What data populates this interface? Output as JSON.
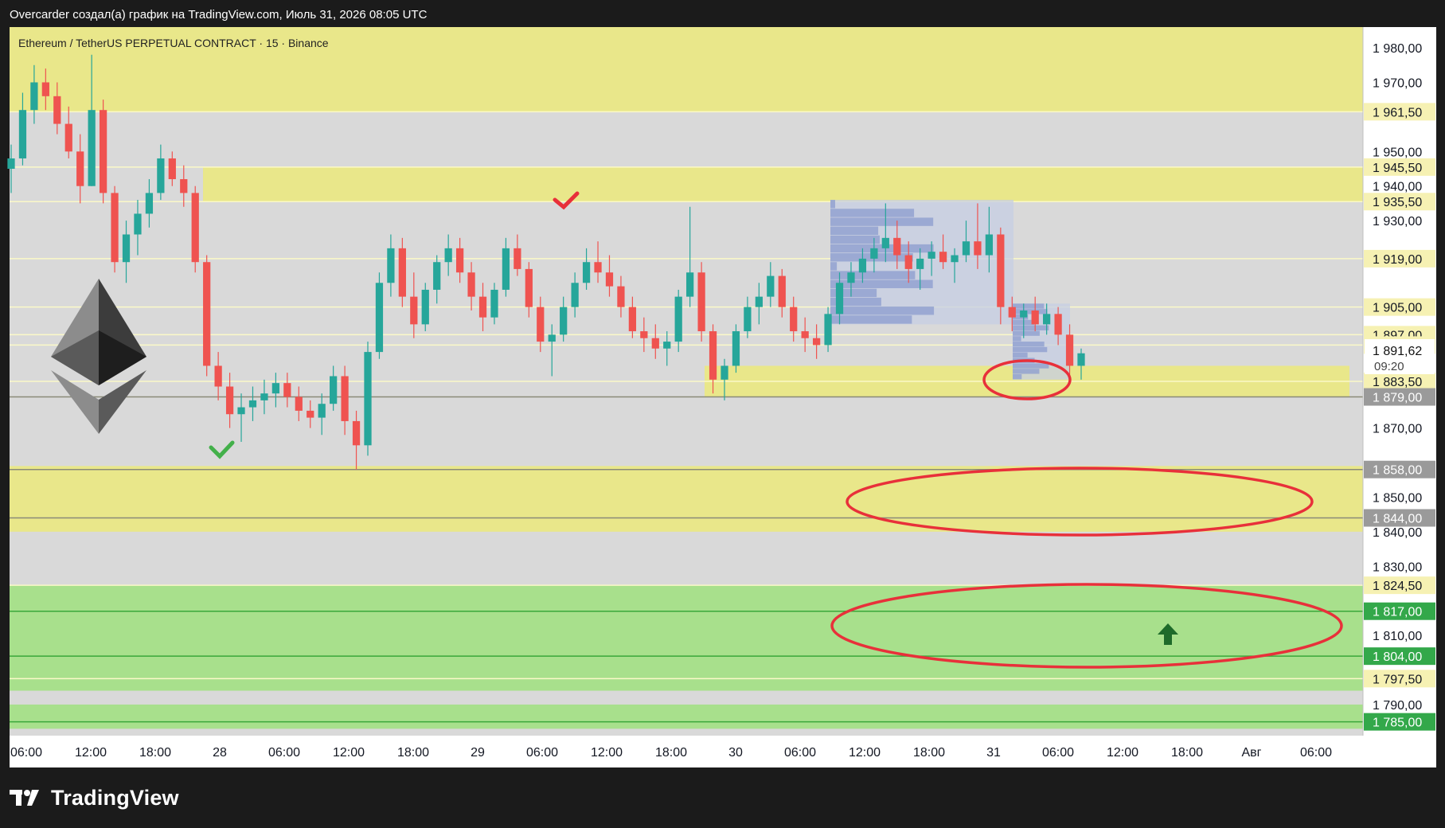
{
  "header": {
    "caption": "Overcarder создал(а) график на TradingView.com, Июль 31, 2026 08:05 UTC"
  },
  "footer": {
    "brand": "TradingView"
  },
  "chart_data": {
    "type": "candlestick",
    "title": "Ethereum / TetherUS PERPETUAL CONTRACT · 15 · Binance",
    "logo": "ethereum-logo",
    "colors": {
      "up": "#26a69a",
      "down": "#ef5350",
      "chart_bg": "#d9d9d9",
      "supply_zone": "#e9e78a",
      "demand_zone": "#a8e08c",
      "annotation": "#e8303a"
    },
    "y_axis": {
      "range": [
        1781,
        1986
      ],
      "ticks": [
        "1 980,00",
        "1 970,00",
        "1 950,00",
        "1 940,00",
        "1 930,00",
        "1 870,00",
        "1 850,00",
        "1 840,00",
        "1 830,00",
        "1 810,00",
        "1 790,00"
      ]
    },
    "x_axis": {
      "labels": [
        "06:00",
        "12:00",
        "18:00",
        "28",
        "06:00",
        "12:00",
        "18:00",
        "29",
        "06:00",
        "12:00",
        "18:00",
        "30",
        "06:00",
        "12:00",
        "18:00",
        "31",
        "06:00",
        "12:00",
        "18:00",
        "Авг",
        "06:00"
      ]
    },
    "current_price": {
      "value": 1891.62,
      "label": "1 891,62",
      "countdown": "09:20"
    },
    "price_levels": [
      {
        "label": "1 961,50",
        "value": 1961.5,
        "style": "yellow"
      },
      {
        "label": "1 945,50",
        "value": 1945.5,
        "style": "yellow"
      },
      {
        "label": "1 935,50",
        "value": 1935.5,
        "style": "yellow"
      },
      {
        "label": "1 919,00",
        "value": 1919.0,
        "style": "yellow"
      },
      {
        "label": "1 905,00",
        "value": 1905.0,
        "style": "yellow"
      },
      {
        "label": "1 897,00",
        "value": 1897.0,
        "style": "yellow"
      },
      {
        "label": "1 894,00",
        "value": 1894.0,
        "style": "yellow"
      },
      {
        "label": "1 883,50",
        "value": 1883.5,
        "style": "yellow"
      },
      {
        "label": "1 879,00",
        "value": 1879.0,
        "style": "gray"
      },
      {
        "label": "1 858,00",
        "value": 1858.0,
        "style": "gray"
      },
      {
        "label": "1 844,00",
        "value": 1844.0,
        "style": "gray"
      },
      {
        "label": "1 824,50",
        "value": 1824.5,
        "style": "yellow"
      },
      {
        "label": "1 817,00",
        "value": 1817.0,
        "style": "green"
      },
      {
        "label": "1 804,00",
        "value": 1804.0,
        "style": "green"
      },
      {
        "label": "1 797,50",
        "value": 1797.5,
        "style": "yellow"
      },
      {
        "label": "1 785,00",
        "value": 1785.0,
        "style": "green"
      }
    ],
    "zones": [
      {
        "type": "supply",
        "from": 1961.5,
        "to": 1986
      },
      {
        "type": "supply",
        "from": 1935.5,
        "to": 1945.5
      },
      {
        "type": "supply",
        "from": 1879,
        "to": 1888
      },
      {
        "type": "supply",
        "from": 1840,
        "to": 1859
      },
      {
        "type": "demand",
        "from": 1794,
        "to": 1824.5
      },
      {
        "type": "demand",
        "from": 1783,
        "to": 1790
      }
    ],
    "candles_ohlc": [
      [
        1945,
        1952,
        1938,
        1948
      ],
      [
        1948,
        1967,
        1946,
        1962
      ],
      [
        1962,
        1975,
        1958,
        1970
      ],
      [
        1970,
        1974,
        1962,
        1966
      ],
      [
        1966,
        1970,
        1955,
        1958
      ],
      [
        1958,
        1963,
        1948,
        1950
      ],
      [
        1950,
        1955,
        1935,
        1940
      ],
      [
        1940,
        1978,
        1940,
        1962
      ],
      [
        1962,
        1965,
        1935,
        1938
      ],
      [
        1938,
        1940,
        1915,
        1918
      ],
      [
        1918,
        1930,
        1912,
        1926
      ],
      [
        1926,
        1936,
        1920,
        1932
      ],
      [
        1932,
        1942,
        1928,
        1938
      ],
      [
        1938,
        1952,
        1936,
        1948
      ],
      [
        1948,
        1950,
        1940,
        1942
      ],
      [
        1942,
        1946,
        1934,
        1938
      ],
      [
        1938,
        1940,
        1915,
        1918
      ],
      [
        1918,
        1920,
        1885,
        1888
      ],
      [
        1888,
        1892,
        1878,
        1882
      ],
      [
        1882,
        1886,
        1870,
        1874
      ],
      [
        1874,
        1880,
        1866,
        1876
      ],
      [
        1876,
        1882,
        1872,
        1878
      ],
      [
        1878,
        1884,
        1874,
        1880
      ],
      [
        1880,
        1886,
        1876,
        1883
      ],
      [
        1883,
        1886,
        1876,
        1879
      ],
      [
        1879,
        1882,
        1872,
        1875
      ],
      [
        1875,
        1878,
        1870,
        1873
      ],
      [
        1873,
        1880,
        1868,
        1877
      ],
      [
        1877,
        1888,
        1875,
        1885
      ],
      [
        1885,
        1888,
        1868,
        1872
      ],
      [
        1872,
        1875,
        1858,
        1865
      ],
      [
        1865,
        1895,
        1862,
        1892
      ],
      [
        1892,
        1915,
        1890,
        1912
      ],
      [
        1912,
        1926,
        1908,
        1922
      ],
      [
        1922,
        1925,
        1905,
        1908
      ],
      [
        1908,
        1915,
        1896,
        1900
      ],
      [
        1900,
        1912,
        1898,
        1910
      ],
      [
        1910,
        1920,
        1906,
        1918
      ],
      [
        1918,
        1926,
        1914,
        1922
      ],
      [
        1922,
        1925,
        1912,
        1915
      ],
      [
        1915,
        1918,
        1904,
        1908
      ],
      [
        1908,
        1912,
        1898,
        1902
      ],
      [
        1902,
        1912,
        1900,
        1910
      ],
      [
        1910,
        1925,
        1908,
        1922
      ],
      [
        1922,
        1926,
        1914,
        1916
      ],
      [
        1916,
        1918,
        1902,
        1905
      ],
      [
        1905,
        1908,
        1892,
        1895
      ],
      [
        1895,
        1900,
        1885,
        1897
      ],
      [
        1897,
        1908,
        1895,
        1905
      ],
      [
        1905,
        1915,
        1902,
        1912
      ],
      [
        1912,
        1922,
        1910,
        1918
      ],
      [
        1918,
        1924,
        1912,
        1915
      ],
      [
        1915,
        1920,
        1908,
        1911
      ],
      [
        1911,
        1914,
        1902,
        1905
      ],
      [
        1905,
        1908,
        1896,
        1898
      ],
      [
        1898,
        1902,
        1892,
        1896
      ],
      [
        1896,
        1900,
        1890,
        1893
      ],
      [
        1893,
        1898,
        1888,
        1895
      ],
      [
        1895,
        1910,
        1892,
        1908
      ],
      [
        1908,
        1934,
        1905,
        1915
      ],
      [
        1915,
        1918,
        1895,
        1898
      ],
      [
        1898,
        1900,
        1880,
        1884
      ],
      [
        1884,
        1890,
        1878,
        1888
      ],
      [
        1888,
        1900,
        1886,
        1898
      ],
      [
        1898,
        1908,
        1896,
        1905
      ],
      [
        1905,
        1912,
        1900,
        1908
      ],
      [
        1908,
        1918,
        1905,
        1914
      ],
      [
        1914,
        1916,
        1902,
        1905
      ],
      [
        1905,
        1908,
        1895,
        1898
      ],
      [
        1898,
        1902,
        1892,
        1896
      ],
      [
        1896,
        1900,
        1890,
        1894
      ],
      [
        1894,
        1905,
        1892,
        1903
      ],
      [
        1903,
        1915,
        1900,
        1912
      ],
      [
        1912,
        1918,
        1908,
        1915
      ],
      [
        1915,
        1922,
        1912,
        1919
      ],
      [
        1919,
        1925,
        1915,
        1922
      ],
      [
        1922,
        1935,
        1918,
        1925
      ],
      [
        1925,
        1930,
        1916,
        1920
      ],
      [
        1920,
        1924,
        1912,
        1916
      ],
      [
        1916,
        1922,
        1910,
        1919
      ],
      [
        1919,
        1924,
        1914,
        1921
      ],
      [
        1921,
        1926,
        1916,
        1918
      ],
      [
        1918,
        1922,
        1912,
        1920
      ],
      [
        1920,
        1930,
        1918,
        1924
      ],
      [
        1924,
        1935,
        1916,
        1920
      ],
      [
        1920,
        1934,
        1915,
        1926
      ],
      [
        1926,
        1928,
        1900,
        1905
      ],
      [
        1905,
        1908,
        1898,
        1902
      ],
      [
        1902,
        1906,
        1896,
        1904
      ],
      [
        1904,
        1908,
        1898,
        1900
      ],
      [
        1900,
        1906,
        1897,
        1903
      ],
      [
        1903,
        1905,
        1894,
        1897
      ],
      [
        1897,
        1900,
        1885,
        1888
      ],
      [
        1888,
        1893,
        1884,
        1891.62
      ]
    ]
  }
}
